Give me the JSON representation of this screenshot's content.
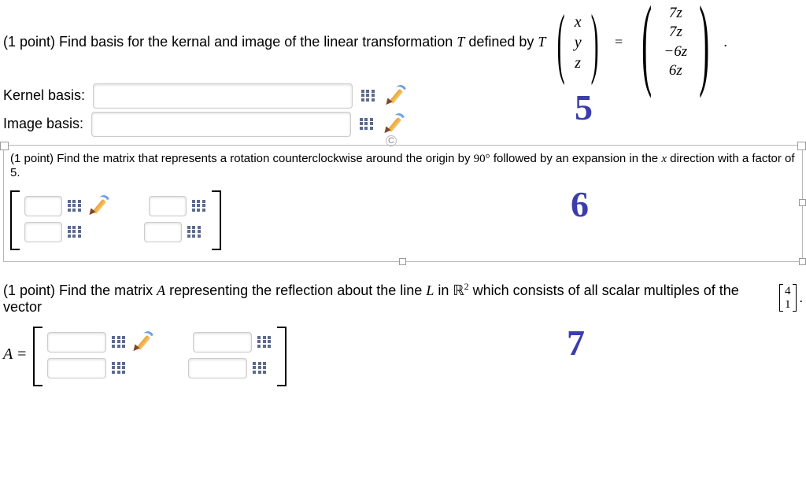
{
  "problem5": {
    "points_prefix": "(1 point) ",
    "text": "Find basis for the kernal and image of the linear transformation ",
    "T": "T",
    "defined_by": " defined by ",
    "input_vec": [
      "x",
      "y",
      "z"
    ],
    "eq": "=",
    "output_vec": [
      "7z",
      "7z",
      "−6z",
      "6z"
    ],
    "period": ".",
    "kernel_label": "Kernel basis:",
    "image_label": "Image basis:",
    "annot": "5"
  },
  "problem6": {
    "points_prefix": "(1 point) ",
    "text1": "Find the matrix that represents a rotation counterclockwise around the origin by ",
    "angle": "90°",
    "text2": " followed by an expansion in the ",
    "xvar": "x",
    "text3": " direction with a factor of 5.",
    "annot": "6"
  },
  "problem7": {
    "points_prefix": "(1 point) ",
    "text1": "Find the matrix ",
    "A": "A",
    "text2": " representing the reflection about the line ",
    "L": "L",
    "text3": " in ",
    "R2": "ℝ",
    "R2sup": "2",
    "text4": " which consists of all scalar multiples of the vector ",
    "vec": [
      "4",
      "1"
    ],
    "period": ".",
    "Aeq": "A =",
    "annot": "7"
  }
}
